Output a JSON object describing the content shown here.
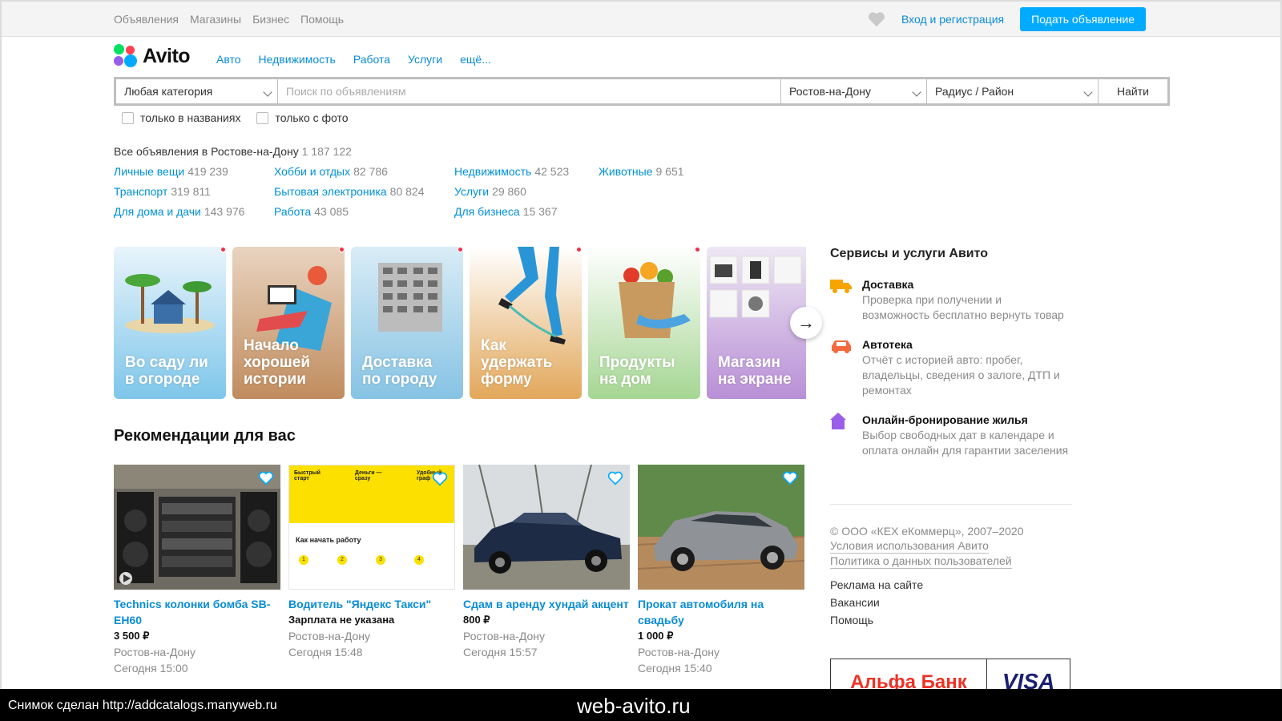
{
  "topbar": {
    "nav": [
      "Объявления",
      "Магазины",
      "Бизнес",
      "Помощь"
    ],
    "login": "Вход и регистрация",
    "post_button": "Подать объявление"
  },
  "logo": {
    "text": "Avito"
  },
  "main_nav": [
    "Авто",
    "Недвижимость",
    "Работа",
    "Услуги",
    "ещё..."
  ],
  "search": {
    "category": "Любая категория",
    "placeholder": "Поиск по объявлениям",
    "city": "Ростов-на-Дону",
    "radius": "Радиус / Район",
    "button": "Найти",
    "check_titles": "только в названиях",
    "check_photo": "только с фото"
  },
  "all_ads": {
    "label": "Все объявления в Ростове-на-Дону",
    "count": "1 187 122"
  },
  "categories": [
    [
      {
        "name": "Личные вещи",
        "count": "419 239"
      },
      {
        "name": "Транспорт",
        "count": "319 811"
      },
      {
        "name": "Для дома и дачи",
        "count": "143 976"
      }
    ],
    [
      {
        "name": "Хобби и отдых",
        "count": "82 786"
      },
      {
        "name": "Бытовая электроника",
        "count": "80 824"
      },
      {
        "name": "Работа",
        "count": "43 085"
      }
    ],
    [
      {
        "name": "Недвижимость",
        "count": "42 523"
      },
      {
        "name": "Услуги",
        "count": "29 860"
      },
      {
        "name": "Для бизнеса",
        "count": "15 367"
      }
    ],
    [
      {
        "name": "Животные",
        "count": "9 651"
      }
    ]
  ],
  "banners": [
    {
      "text": "Во саду ли в огороде",
      "color": "#7ec6ea"
    },
    {
      "text": "Начало хорошей истории",
      "color": "#c99566"
    },
    {
      "text": "Доставка по городу",
      "color": "#86c3e4"
    },
    {
      "text": "Как удержать форму",
      "color": "#e8b36a"
    },
    {
      "text": "Продукты на дом",
      "color": "#9fd18c"
    },
    {
      "text": "Магазин на экране",
      "color": "#b88fd6"
    }
  ],
  "recommendations": {
    "title": "Рекомендации для вас",
    "items": [
      {
        "title": "Technics колонки бомба SB-EH60",
        "price": "3 500 ₽",
        "location": "Ростов-на-Дону",
        "time": "Сегодня 15:00"
      },
      {
        "title": "Водитель \"Яндекс Такси\"",
        "price": "Зарплата не указана",
        "location": "Ростов-на-Дону",
        "time": "Сегодня 15:48"
      },
      {
        "title": "Сдам в аренду хундай акцент",
        "price": "800 ₽",
        "location": "Ростов-на-Дону",
        "time": "Сегодня 15:57"
      },
      {
        "title": "Прокат автомобиля на свадьбу",
        "price": "1 000 ₽",
        "location": "Ростов-на-Дону",
        "time": "Сегодня 15:40"
      }
    ],
    "yandex_ad": {
      "cols": [
        "Быстрый старт",
        "Деньги — сразу",
        "Удобный граф"
      ],
      "heading": "Как начать работу",
      "steps": [
        "1",
        "2",
        "3",
        "4"
      ]
    }
  },
  "services": {
    "title": "Сервисы и услуги Авито",
    "items": [
      {
        "name": "Доставка",
        "desc": "Проверка при получении и возможность бесплатно вернуть товар",
        "icon": "truck-icon"
      },
      {
        "name": "Автотека",
        "desc": "Отчёт с историей авто: пробег, владельцы, сведения о залоге, ДТП и ремонтах",
        "icon": "car-icon"
      },
      {
        "name": "Онлайн-бронирование жилья",
        "desc": "Выбор свободных дат в календаре и оплата онлайн для гарантии заселения",
        "icon": "house-icon"
      }
    ]
  },
  "footer": {
    "copyright": "© ООО «КЕХ еКоммерц», 2007–2020",
    "terms": "Условия использования Авито",
    "privacy": "Политика о данных пользователей",
    "links": [
      "Реклама на сайте",
      "Вакансии",
      "Помощь"
    ]
  },
  "ad_banner": {
    "left": "Альфа Банк",
    "right": "VISA"
  },
  "watermark": {
    "left": "Снимок сделан http://addcatalogs.manyweb.ru",
    "center": "web-avito.ru"
  },
  "colors": {
    "accent": "#00aaff",
    "link": "#0a8cd6",
    "heart": "#ffffff"
  }
}
